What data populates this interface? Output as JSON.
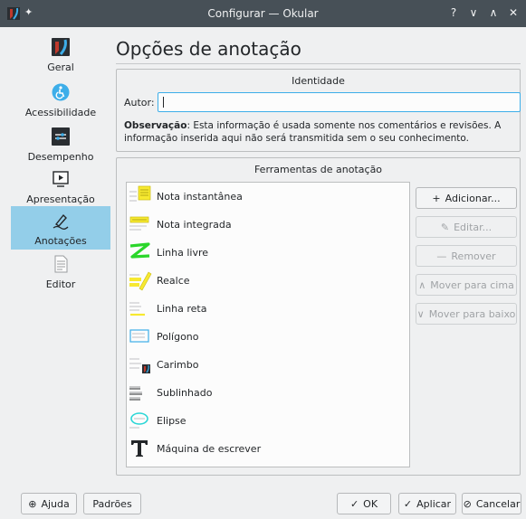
{
  "window": {
    "title": "Configurar — Okular",
    "buttons": {
      "help": "?",
      "minimize": "∨",
      "maximize": "∧",
      "close": "✕"
    }
  },
  "sidebar": {
    "items": [
      {
        "label": "Geral",
        "icon": "okular-icon",
        "active": false
      },
      {
        "label": "Acessibilidade",
        "icon": "accessibility-icon",
        "active": false
      },
      {
        "label": "Desempenho",
        "icon": "performance-icon",
        "active": false
      },
      {
        "label": "Apresentação",
        "icon": "presentation-icon",
        "active": false
      },
      {
        "label": "Anotações",
        "icon": "annotation-pen-icon",
        "active": true
      },
      {
        "label": "Editor",
        "icon": "editor-document-icon",
        "active": false
      }
    ]
  },
  "main": {
    "title": "Opções de anotação",
    "identity": {
      "title": "Identidade",
      "autor_label": "Autor:",
      "autor_value": "",
      "note_bold": "Observação",
      "note_text": ": Esta informação é usada somente nos comentários e revisões. A informação inserida aqui não será transmitida sem o seu conhecimento."
    },
    "tools": {
      "title": "Ferramentas de anotação",
      "items": [
        {
          "label": "Nota instantânea",
          "icon": "sticky-note-icon"
        },
        {
          "label": "Nota integrada",
          "icon": "inline-note-icon"
        },
        {
          "label": "Linha livre",
          "icon": "freehand-line-icon"
        },
        {
          "label": "Realce",
          "icon": "highlighter-icon"
        },
        {
          "label": "Linha reta",
          "icon": "straight-line-icon"
        },
        {
          "label": "Polígono",
          "icon": "polygon-icon"
        },
        {
          "label": "Carimbo",
          "icon": "stamp-icon"
        },
        {
          "label": "Sublinhado",
          "icon": "underline-icon"
        },
        {
          "label": "Elipse",
          "icon": "ellipse-icon"
        },
        {
          "label": "Máquina de escrever",
          "icon": "typewriter-icon"
        }
      ],
      "buttons": {
        "add": "Adicionar...",
        "edit": "Editar...",
        "remove": "Remover",
        "move_up": "Mover para cima",
        "move_down": "Mover para baixo"
      }
    }
  },
  "footer": {
    "help": "Ajuda",
    "defaults": "Padrões",
    "ok": "OK",
    "apply": "Aplicar",
    "cancel": "Cancelar"
  },
  "colors": {
    "titlebar": "#475057",
    "selection": "#93cee9",
    "focus": "#3daee9",
    "note_yellow": "#f7e930",
    "freehand_green": "#2bd62b",
    "ellipse_cyan": "#2bd6d6"
  }
}
